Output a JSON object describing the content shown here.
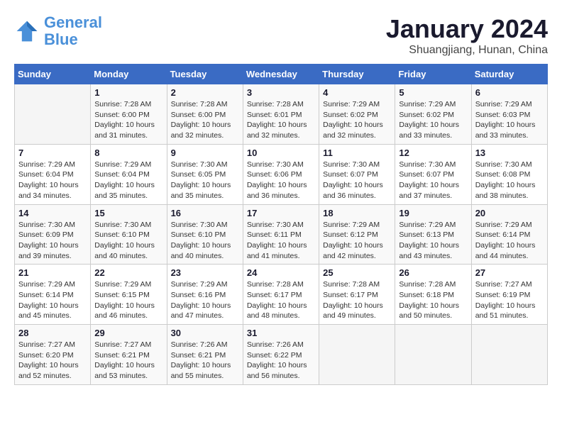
{
  "header": {
    "logo_line1": "General",
    "logo_line2": "Blue",
    "title": "January 2024",
    "subtitle": "Shuangjiang, Hunan, China"
  },
  "weekdays": [
    "Sunday",
    "Monday",
    "Tuesday",
    "Wednesday",
    "Thursday",
    "Friday",
    "Saturday"
  ],
  "weeks": [
    [
      {
        "day": "",
        "info": ""
      },
      {
        "day": "1",
        "info": "Sunrise: 7:28 AM\nSunset: 6:00 PM\nDaylight: 10 hours\nand 31 minutes."
      },
      {
        "day": "2",
        "info": "Sunrise: 7:28 AM\nSunset: 6:00 PM\nDaylight: 10 hours\nand 32 minutes."
      },
      {
        "day": "3",
        "info": "Sunrise: 7:28 AM\nSunset: 6:01 PM\nDaylight: 10 hours\nand 32 minutes."
      },
      {
        "day": "4",
        "info": "Sunrise: 7:29 AM\nSunset: 6:02 PM\nDaylight: 10 hours\nand 32 minutes."
      },
      {
        "day": "5",
        "info": "Sunrise: 7:29 AM\nSunset: 6:02 PM\nDaylight: 10 hours\nand 33 minutes."
      },
      {
        "day": "6",
        "info": "Sunrise: 7:29 AM\nSunset: 6:03 PM\nDaylight: 10 hours\nand 33 minutes."
      }
    ],
    [
      {
        "day": "7",
        "info": "Sunrise: 7:29 AM\nSunset: 6:04 PM\nDaylight: 10 hours\nand 34 minutes."
      },
      {
        "day": "8",
        "info": "Sunrise: 7:29 AM\nSunset: 6:04 PM\nDaylight: 10 hours\nand 35 minutes."
      },
      {
        "day": "9",
        "info": "Sunrise: 7:30 AM\nSunset: 6:05 PM\nDaylight: 10 hours\nand 35 minutes."
      },
      {
        "day": "10",
        "info": "Sunrise: 7:30 AM\nSunset: 6:06 PM\nDaylight: 10 hours\nand 36 minutes."
      },
      {
        "day": "11",
        "info": "Sunrise: 7:30 AM\nSunset: 6:07 PM\nDaylight: 10 hours\nand 36 minutes."
      },
      {
        "day": "12",
        "info": "Sunrise: 7:30 AM\nSunset: 6:07 PM\nDaylight: 10 hours\nand 37 minutes."
      },
      {
        "day": "13",
        "info": "Sunrise: 7:30 AM\nSunset: 6:08 PM\nDaylight: 10 hours\nand 38 minutes."
      }
    ],
    [
      {
        "day": "14",
        "info": "Sunrise: 7:30 AM\nSunset: 6:09 PM\nDaylight: 10 hours\nand 39 minutes."
      },
      {
        "day": "15",
        "info": "Sunrise: 7:30 AM\nSunset: 6:10 PM\nDaylight: 10 hours\nand 40 minutes."
      },
      {
        "day": "16",
        "info": "Sunrise: 7:30 AM\nSunset: 6:10 PM\nDaylight: 10 hours\nand 40 minutes."
      },
      {
        "day": "17",
        "info": "Sunrise: 7:30 AM\nSunset: 6:11 PM\nDaylight: 10 hours\nand 41 minutes."
      },
      {
        "day": "18",
        "info": "Sunrise: 7:29 AM\nSunset: 6:12 PM\nDaylight: 10 hours\nand 42 minutes."
      },
      {
        "day": "19",
        "info": "Sunrise: 7:29 AM\nSunset: 6:13 PM\nDaylight: 10 hours\nand 43 minutes."
      },
      {
        "day": "20",
        "info": "Sunrise: 7:29 AM\nSunset: 6:14 PM\nDaylight: 10 hours\nand 44 minutes."
      }
    ],
    [
      {
        "day": "21",
        "info": "Sunrise: 7:29 AM\nSunset: 6:14 PM\nDaylight: 10 hours\nand 45 minutes."
      },
      {
        "day": "22",
        "info": "Sunrise: 7:29 AM\nSunset: 6:15 PM\nDaylight: 10 hours\nand 46 minutes."
      },
      {
        "day": "23",
        "info": "Sunrise: 7:29 AM\nSunset: 6:16 PM\nDaylight: 10 hours\nand 47 minutes."
      },
      {
        "day": "24",
        "info": "Sunrise: 7:28 AM\nSunset: 6:17 PM\nDaylight: 10 hours\nand 48 minutes."
      },
      {
        "day": "25",
        "info": "Sunrise: 7:28 AM\nSunset: 6:17 PM\nDaylight: 10 hours\nand 49 minutes."
      },
      {
        "day": "26",
        "info": "Sunrise: 7:28 AM\nSunset: 6:18 PM\nDaylight: 10 hours\nand 50 minutes."
      },
      {
        "day": "27",
        "info": "Sunrise: 7:27 AM\nSunset: 6:19 PM\nDaylight: 10 hours\nand 51 minutes."
      }
    ],
    [
      {
        "day": "28",
        "info": "Sunrise: 7:27 AM\nSunset: 6:20 PM\nDaylight: 10 hours\nand 52 minutes."
      },
      {
        "day": "29",
        "info": "Sunrise: 7:27 AM\nSunset: 6:21 PM\nDaylight: 10 hours\nand 53 minutes."
      },
      {
        "day": "30",
        "info": "Sunrise: 7:26 AM\nSunset: 6:21 PM\nDaylight: 10 hours\nand 55 minutes."
      },
      {
        "day": "31",
        "info": "Sunrise: 7:26 AM\nSunset: 6:22 PM\nDaylight: 10 hours\nand 56 minutes."
      },
      {
        "day": "",
        "info": ""
      },
      {
        "day": "",
        "info": ""
      },
      {
        "day": "",
        "info": ""
      }
    ]
  ]
}
